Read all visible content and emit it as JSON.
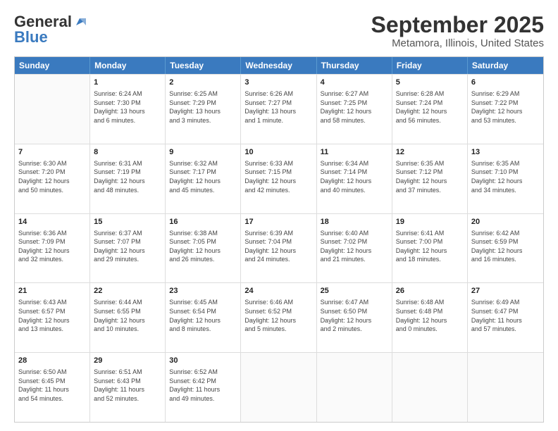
{
  "header": {
    "logo_general": "General",
    "logo_blue": "Blue",
    "title": "September 2025",
    "subtitle": "Metamora, Illinois, United States"
  },
  "calendar": {
    "days": [
      "Sunday",
      "Monday",
      "Tuesday",
      "Wednesday",
      "Thursday",
      "Friday",
      "Saturday"
    ],
    "weeks": [
      [
        {
          "date": "",
          "info": ""
        },
        {
          "date": "1",
          "info": "Sunrise: 6:24 AM\nSunset: 7:30 PM\nDaylight: 13 hours\nand 6 minutes."
        },
        {
          "date": "2",
          "info": "Sunrise: 6:25 AM\nSunset: 7:29 PM\nDaylight: 13 hours\nand 3 minutes."
        },
        {
          "date": "3",
          "info": "Sunrise: 6:26 AM\nSunset: 7:27 PM\nDaylight: 13 hours\nand 1 minute."
        },
        {
          "date": "4",
          "info": "Sunrise: 6:27 AM\nSunset: 7:25 PM\nDaylight: 12 hours\nand 58 minutes."
        },
        {
          "date": "5",
          "info": "Sunrise: 6:28 AM\nSunset: 7:24 PM\nDaylight: 12 hours\nand 56 minutes."
        },
        {
          "date": "6",
          "info": "Sunrise: 6:29 AM\nSunset: 7:22 PM\nDaylight: 12 hours\nand 53 minutes."
        }
      ],
      [
        {
          "date": "7",
          "info": "Sunrise: 6:30 AM\nSunset: 7:20 PM\nDaylight: 12 hours\nand 50 minutes."
        },
        {
          "date": "8",
          "info": "Sunrise: 6:31 AM\nSunset: 7:19 PM\nDaylight: 12 hours\nand 48 minutes."
        },
        {
          "date": "9",
          "info": "Sunrise: 6:32 AM\nSunset: 7:17 PM\nDaylight: 12 hours\nand 45 minutes."
        },
        {
          "date": "10",
          "info": "Sunrise: 6:33 AM\nSunset: 7:15 PM\nDaylight: 12 hours\nand 42 minutes."
        },
        {
          "date": "11",
          "info": "Sunrise: 6:34 AM\nSunset: 7:14 PM\nDaylight: 12 hours\nand 40 minutes."
        },
        {
          "date": "12",
          "info": "Sunrise: 6:35 AM\nSunset: 7:12 PM\nDaylight: 12 hours\nand 37 minutes."
        },
        {
          "date": "13",
          "info": "Sunrise: 6:35 AM\nSunset: 7:10 PM\nDaylight: 12 hours\nand 34 minutes."
        }
      ],
      [
        {
          "date": "14",
          "info": "Sunrise: 6:36 AM\nSunset: 7:09 PM\nDaylight: 12 hours\nand 32 minutes."
        },
        {
          "date": "15",
          "info": "Sunrise: 6:37 AM\nSunset: 7:07 PM\nDaylight: 12 hours\nand 29 minutes."
        },
        {
          "date": "16",
          "info": "Sunrise: 6:38 AM\nSunset: 7:05 PM\nDaylight: 12 hours\nand 26 minutes."
        },
        {
          "date": "17",
          "info": "Sunrise: 6:39 AM\nSunset: 7:04 PM\nDaylight: 12 hours\nand 24 minutes."
        },
        {
          "date": "18",
          "info": "Sunrise: 6:40 AM\nSunset: 7:02 PM\nDaylight: 12 hours\nand 21 minutes."
        },
        {
          "date": "19",
          "info": "Sunrise: 6:41 AM\nSunset: 7:00 PM\nDaylight: 12 hours\nand 18 minutes."
        },
        {
          "date": "20",
          "info": "Sunrise: 6:42 AM\nSunset: 6:59 PM\nDaylight: 12 hours\nand 16 minutes."
        }
      ],
      [
        {
          "date": "21",
          "info": "Sunrise: 6:43 AM\nSunset: 6:57 PM\nDaylight: 12 hours\nand 13 minutes."
        },
        {
          "date": "22",
          "info": "Sunrise: 6:44 AM\nSunset: 6:55 PM\nDaylight: 12 hours\nand 10 minutes."
        },
        {
          "date": "23",
          "info": "Sunrise: 6:45 AM\nSunset: 6:54 PM\nDaylight: 12 hours\nand 8 minutes."
        },
        {
          "date": "24",
          "info": "Sunrise: 6:46 AM\nSunset: 6:52 PM\nDaylight: 12 hours\nand 5 minutes."
        },
        {
          "date": "25",
          "info": "Sunrise: 6:47 AM\nSunset: 6:50 PM\nDaylight: 12 hours\nand 2 minutes."
        },
        {
          "date": "26",
          "info": "Sunrise: 6:48 AM\nSunset: 6:48 PM\nDaylight: 12 hours\nand 0 minutes."
        },
        {
          "date": "27",
          "info": "Sunrise: 6:49 AM\nSunset: 6:47 PM\nDaylight: 11 hours\nand 57 minutes."
        }
      ],
      [
        {
          "date": "28",
          "info": "Sunrise: 6:50 AM\nSunset: 6:45 PM\nDaylight: 11 hours\nand 54 minutes."
        },
        {
          "date": "29",
          "info": "Sunrise: 6:51 AM\nSunset: 6:43 PM\nDaylight: 11 hours\nand 52 minutes."
        },
        {
          "date": "30",
          "info": "Sunrise: 6:52 AM\nSunset: 6:42 PM\nDaylight: 11 hours\nand 49 minutes."
        },
        {
          "date": "",
          "info": ""
        },
        {
          "date": "",
          "info": ""
        },
        {
          "date": "",
          "info": ""
        },
        {
          "date": "",
          "info": ""
        }
      ]
    ]
  }
}
